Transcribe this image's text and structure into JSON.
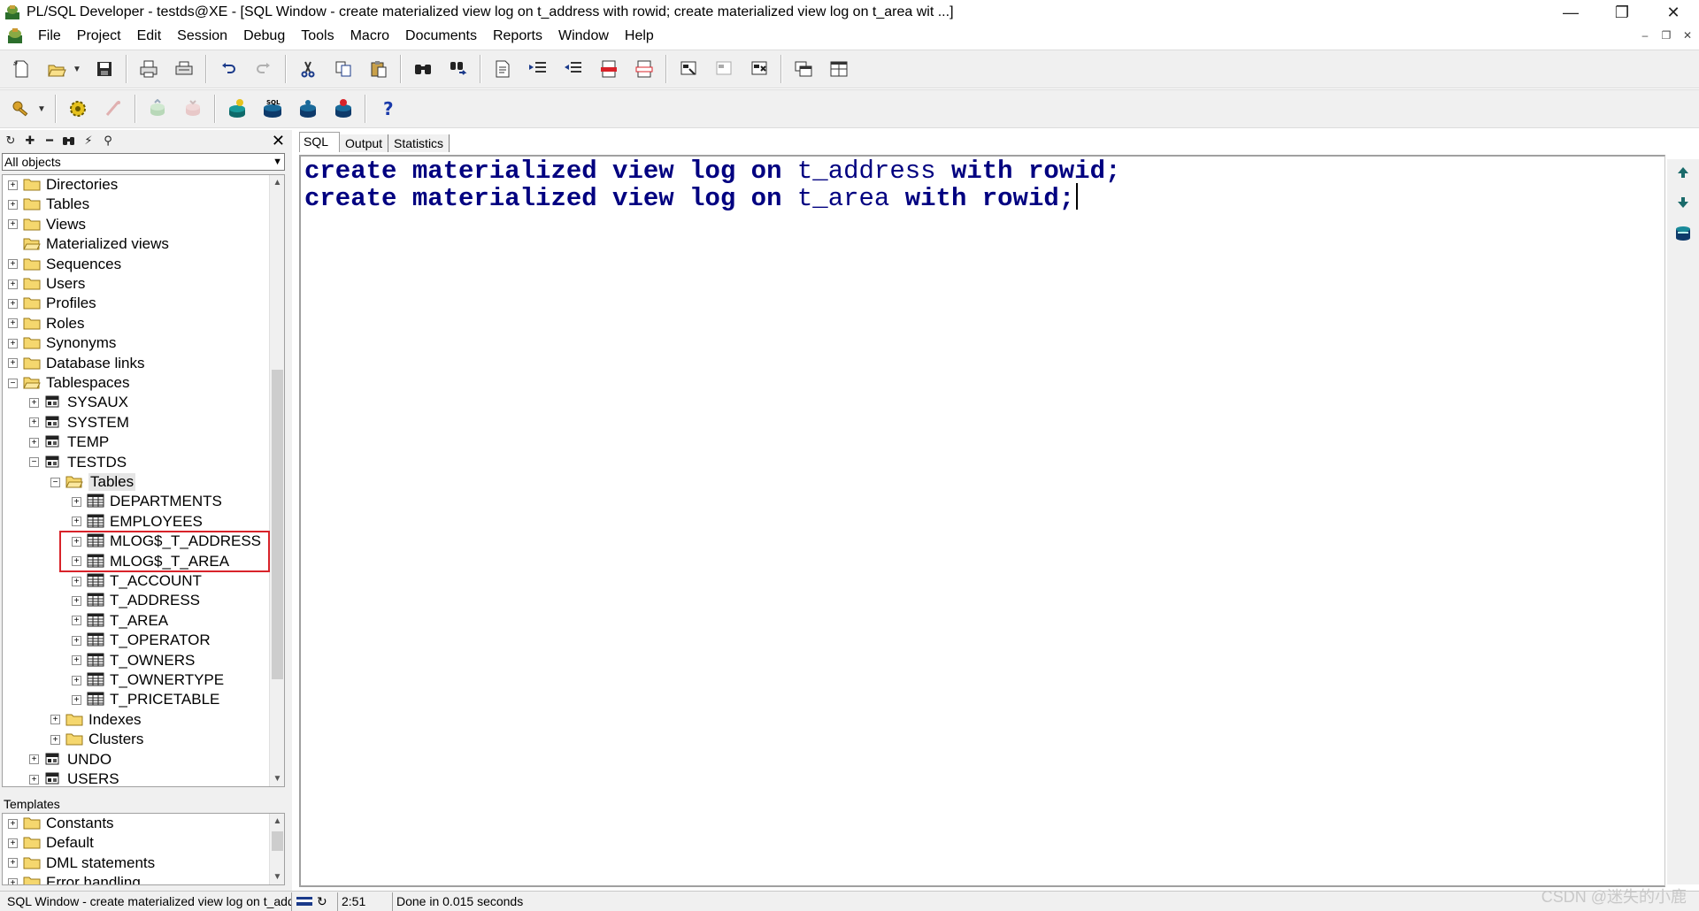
{
  "window": {
    "title": "PL/SQL Developer - testds@XE - [SQL Window - create materialized view log on t_address with rowid; create materialized view log on t_area wit ...]",
    "minimize": "—",
    "restore": "❐",
    "close": "✕"
  },
  "menu": {
    "items": [
      "File",
      "Project",
      "Edit",
      "Session",
      "Debug",
      "Tools",
      "Macro",
      "Documents",
      "Reports",
      "Window",
      "Help"
    ],
    "mdi_minimize": "–",
    "mdi_restore": "❐",
    "mdi_close": "✕"
  },
  "browser": {
    "close": "✕",
    "filter": "All objects",
    "filter_arrow": "▼",
    "tree": [
      {
        "label": "Directories",
        "expander": "+"
      },
      {
        "label": "Tables",
        "expander": "+"
      },
      {
        "label": "Views",
        "expander": "+"
      },
      {
        "label": "Materialized views",
        "expander": ""
      },
      {
        "label": "Sequences",
        "expander": "+"
      },
      {
        "label": "Users",
        "expander": "+"
      },
      {
        "label": "Profiles",
        "expander": "+"
      },
      {
        "label": "Roles",
        "expander": "+"
      },
      {
        "label": "Synonyms",
        "expander": "+"
      },
      {
        "label": "Database links",
        "expander": "+"
      },
      {
        "label": "Tablespaces",
        "expander": "−"
      },
      {
        "label": "SYSAUX",
        "expander": "+"
      },
      {
        "label": "SYSTEM",
        "expander": "+"
      },
      {
        "label": "TEMP",
        "expander": "+"
      },
      {
        "label": "TESTDS",
        "expander": "−"
      },
      {
        "label": "Tables",
        "expander": "−"
      },
      {
        "label": "DEPARTMENTS",
        "expander": "+"
      },
      {
        "label": "EMPLOYEES",
        "expander": "+"
      },
      {
        "label": "MLOG$_T_ADDRESS",
        "expander": "+"
      },
      {
        "label": "MLOG$_T_AREA",
        "expander": "+"
      },
      {
        "label": "T_ACCOUNT",
        "expander": "+"
      },
      {
        "label": "T_ADDRESS",
        "expander": "+"
      },
      {
        "label": "T_AREA",
        "expander": "+"
      },
      {
        "label": "T_OPERATOR",
        "expander": "+"
      },
      {
        "label": "T_OWNERS",
        "expander": "+"
      },
      {
        "label": "T_OWNERTYPE",
        "expander": "+"
      },
      {
        "label": "T_PRICETABLE",
        "expander": "+"
      },
      {
        "label": "Indexes",
        "expander": "+"
      },
      {
        "label": "Clusters",
        "expander": "+"
      },
      {
        "label": "UNDO",
        "expander": "+"
      },
      {
        "label": "USERS",
        "expander": "+"
      }
    ],
    "scroll_up": "▲",
    "scroll_down": "▼"
  },
  "templates": {
    "label": "Templates",
    "items": [
      {
        "label": "Constants",
        "expander": "+"
      },
      {
        "label": "Default",
        "expander": "+"
      },
      {
        "label": "DML statements",
        "expander": "+"
      },
      {
        "label": "Error handling",
        "expander": "+"
      }
    ]
  },
  "tabs": {
    "sql": "SQL",
    "output": "Output",
    "statistics": "Statistics"
  },
  "editor": {
    "line1": {
      "kw1": "create materialized view log on",
      "ident": "t_address",
      "kw2": "with rowid;"
    },
    "line2": {
      "kw1": "create materialized view log on",
      "ident": "t_area",
      "kw2": "with rowid;"
    }
  },
  "status": {
    "window_caption": "SQL Window - create materialized view log on t_address",
    "position": "2:51",
    "message": "Done in 0.015 seconds"
  },
  "watermark": "CSDN @迷失的小鹿"
}
